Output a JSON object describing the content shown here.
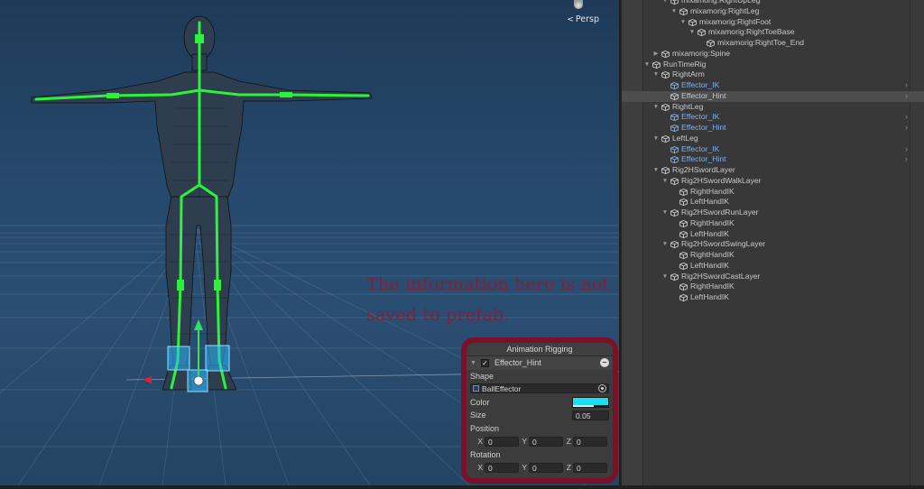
{
  "scene": {
    "view_label": "Persp",
    "view_arrow": "<",
    "overlay_note": "The information here is not saved to prefab.",
    "colors": {
      "background_top": "#1f3a58",
      "background_bottom": "#2a4e72",
      "mesh_wire": "#3a3a3a",
      "bones": "#2cf33a",
      "effector": "#2bb8ff",
      "gizmo_up": "#34e25a",
      "gizmo_left": "#e01f2a",
      "note": "#91192d"
    }
  },
  "rig_panel": {
    "title": "Animation Rigging",
    "effector_name": "Effector_Hint",
    "enabled_mark": "✓",
    "remove_icon": "minus-circle-icon",
    "shape_label": "Shape",
    "shape_value": "BallEffector",
    "color_label": "Color",
    "color_value": "#19e0f1",
    "size_label": "Size",
    "size_value": "0.05",
    "position_label": "Position",
    "position": {
      "x_label": "X",
      "x": "0",
      "y_label": "Y",
      "y": "0",
      "z_label": "Z",
      "z": "0"
    },
    "rotation_label": "Rotation",
    "rotation": {
      "x_label": "X",
      "x": "0",
      "y_label": "Y",
      "y": "0",
      "z_label": "Z",
      "z": "0"
    },
    "border_color": "#7c1029"
  },
  "hierarchy": {
    "rows": [
      {
        "name": "mixamorig:RightUpLeg",
        "depth": 4,
        "expanded": true,
        "color": "normal"
      },
      {
        "name": "mixamorig:RightLeg",
        "depth": 5,
        "expanded": true,
        "color": "normal"
      },
      {
        "name": "mixamorig:RightFoot",
        "depth": 6,
        "expanded": true,
        "color": "normal"
      },
      {
        "name": "mixamorig:RightToeBase",
        "depth": 7,
        "expanded": true,
        "color": "normal"
      },
      {
        "name": "mixamorig:RightToe_End",
        "depth": 8,
        "expanded": null,
        "color": "normal"
      },
      {
        "name": "mixamorig:Spine",
        "depth": 3,
        "expanded": false,
        "color": "normal"
      },
      {
        "name": "RunTimeRig",
        "depth": 2,
        "expanded": true,
        "color": "normal"
      },
      {
        "name": "RightArm",
        "depth": 3,
        "expanded": true,
        "color": "normal"
      },
      {
        "name": "Effector_IK",
        "depth": 4,
        "expanded": null,
        "color": "blue",
        "has_arrow": true
      },
      {
        "name": "Effector_Hint",
        "depth": 4,
        "expanded": null,
        "color": "normal",
        "selected": true,
        "has_arrow": true
      },
      {
        "name": "RightLeg",
        "depth": 3,
        "expanded": true,
        "color": "normal"
      },
      {
        "name": "Effector_IK",
        "depth": 4,
        "expanded": null,
        "color": "blue",
        "has_arrow": true
      },
      {
        "name": "Effector_Hint",
        "depth": 4,
        "expanded": null,
        "color": "blue",
        "has_arrow": true
      },
      {
        "name": "LeftLeg",
        "depth": 3,
        "expanded": true,
        "color": "normal"
      },
      {
        "name": "Effector_IK",
        "depth": 4,
        "expanded": null,
        "color": "blue",
        "has_arrow": true
      },
      {
        "name": "Effector_Hint",
        "depth": 4,
        "expanded": null,
        "color": "blue",
        "has_arrow": true
      },
      {
        "name": "Rig2HSwordLayer",
        "depth": 3,
        "expanded": true,
        "color": "normal"
      },
      {
        "name": "Rig2HSwordWalkLayer",
        "depth": 4,
        "expanded": true,
        "color": "normal"
      },
      {
        "name": "RightHandIK",
        "depth": 5,
        "expanded": null,
        "color": "normal"
      },
      {
        "name": "LeftHandIK",
        "depth": 5,
        "expanded": null,
        "color": "normal"
      },
      {
        "name": "Rig2HSwordRunLayer",
        "depth": 4,
        "expanded": true,
        "color": "normal"
      },
      {
        "name": "RightHandIK",
        "depth": 5,
        "expanded": null,
        "color": "normal"
      },
      {
        "name": "LeftHandIK",
        "depth": 5,
        "expanded": null,
        "color": "normal"
      },
      {
        "name": "Rig2HSwordSwingLayer",
        "depth": 4,
        "expanded": true,
        "color": "normal"
      },
      {
        "name": "RightHandIK",
        "depth": 5,
        "expanded": null,
        "color": "normal"
      },
      {
        "name": "LeftHandIK",
        "depth": 5,
        "expanded": null,
        "color": "normal"
      },
      {
        "name": "Rig2HSwordCastLayer",
        "depth": 4,
        "expanded": true,
        "color": "normal"
      },
      {
        "name": "RightHandIK",
        "depth": 5,
        "expanded": null,
        "color": "normal"
      },
      {
        "name": "LeftHandIK",
        "depth": 5,
        "expanded": null,
        "color": "normal"
      }
    ],
    "colors": {
      "text": "#c8c8c8",
      "blue_text": "#7fb2f0",
      "selected_bg": "#4d4d4d"
    }
  }
}
